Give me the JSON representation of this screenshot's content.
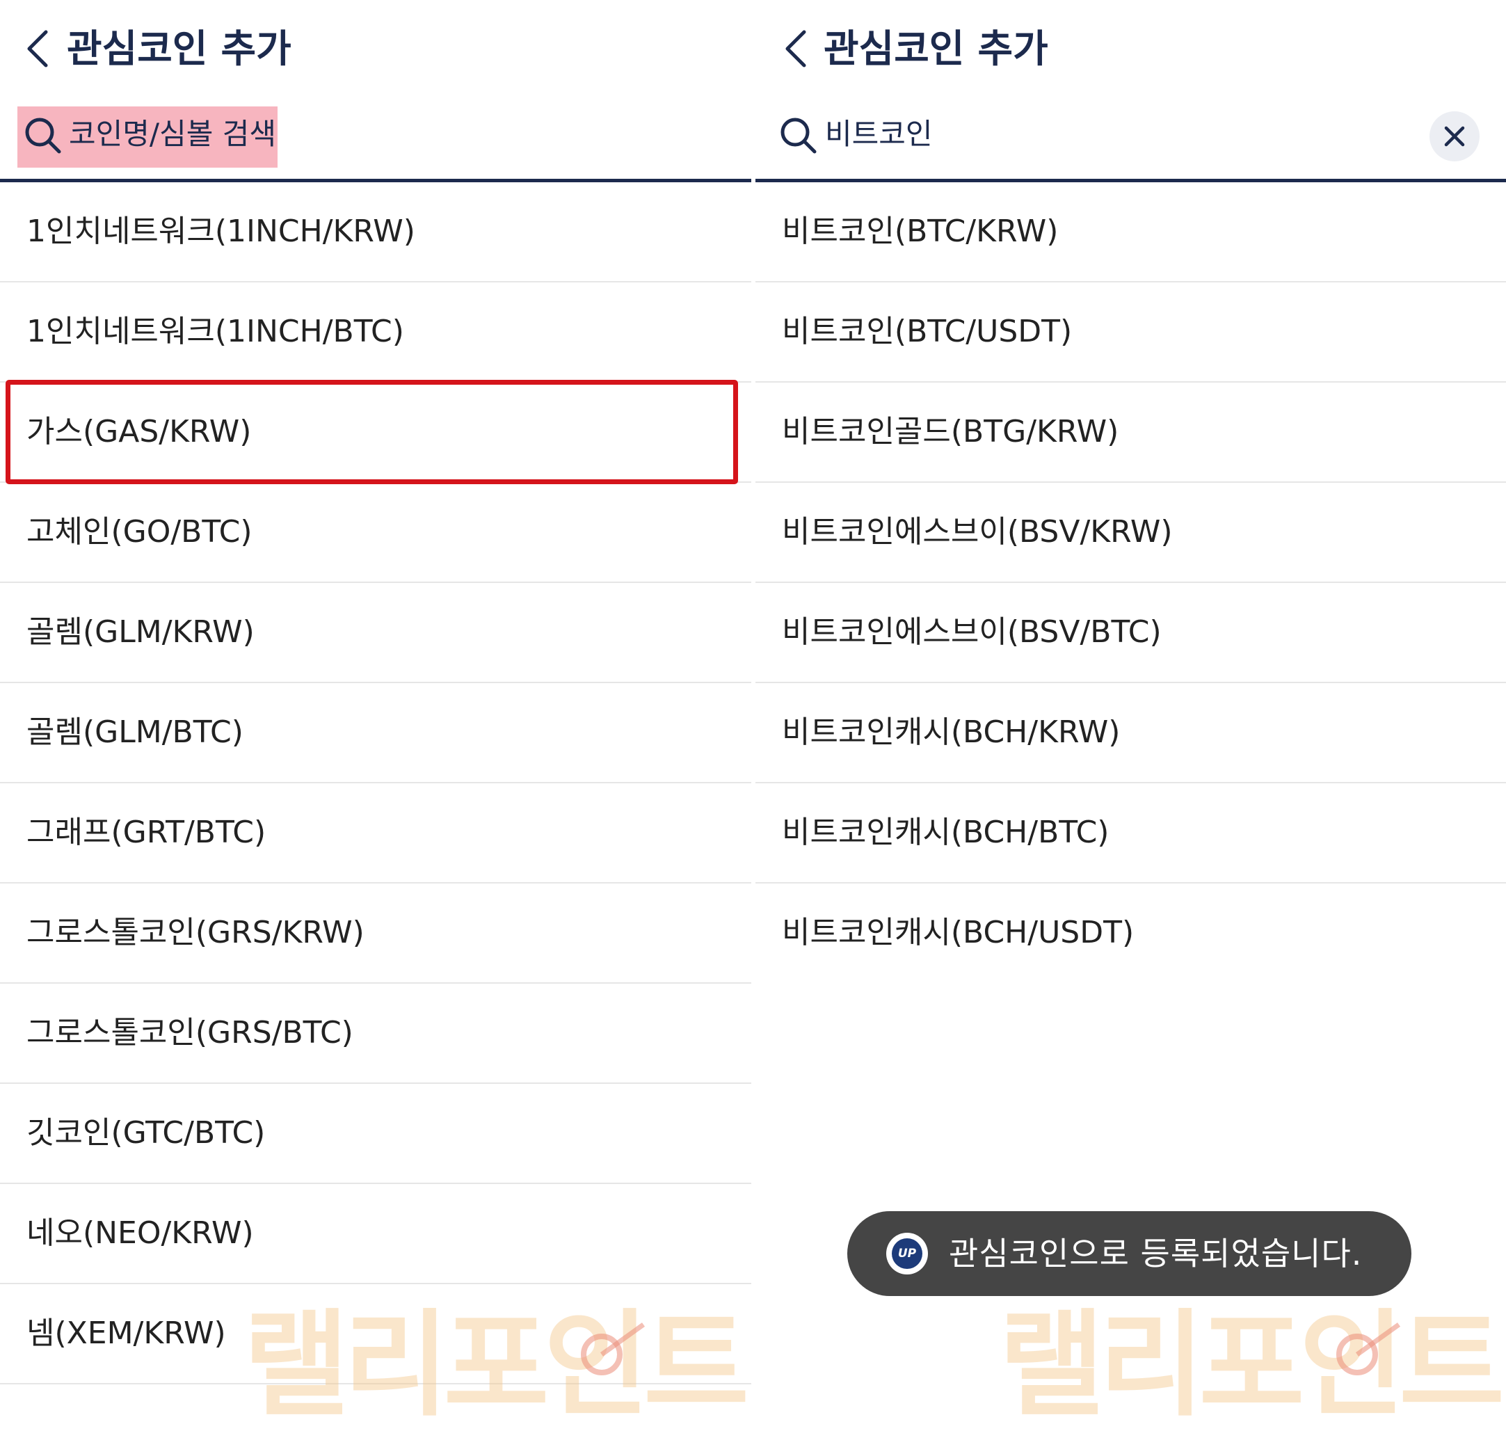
{
  "left": {
    "title": "관심코인 추가",
    "search_placeholder": "코인명/심볼 검색",
    "items": [
      "1인치네트워크(1INCH/KRW)",
      "1인치네트워크(1INCH/BTC)",
      "가스(GAS/KRW)",
      "고체인(GO/BTC)",
      "골렘(GLM/KRW)",
      "골렘(GLM/BTC)",
      "그래프(GRT/BTC)",
      "그로스톨코인(GRS/KRW)",
      "그로스톨코인(GRS/BTC)",
      "깃코인(GTC/BTC)",
      "네오(NEO/KRW)",
      "넴(XEM/KRW)"
    ]
  },
  "right": {
    "title": "관심코인 추가",
    "search_value": "비트코인",
    "items": [
      "비트코인(BTC/KRW)",
      "비트코인(BTC/USDT)",
      "비트코인골드(BTG/KRW)",
      "비트코인에스브이(BSV/KRW)",
      "비트코인에스브이(BSV/BTC)",
      "비트코인캐시(BCH/KRW)",
      "비트코인캐시(BCH/BTC)",
      "비트코인캐시(BCH/USDT)"
    ]
  },
  "toast": {
    "logo_text": "UP",
    "message": "관심코인으로 등록되었습니다."
  },
  "watermark": "랠리포인트",
  "colors": {
    "accent_navy": "#1c2a4d",
    "search_highlight": "#f7b5bf",
    "selection_box": "#d5141b",
    "toast_bg": "#454545"
  },
  "icons": {
    "back": "chevron-left-icon",
    "search": "search-icon",
    "clear": "close-icon"
  }
}
